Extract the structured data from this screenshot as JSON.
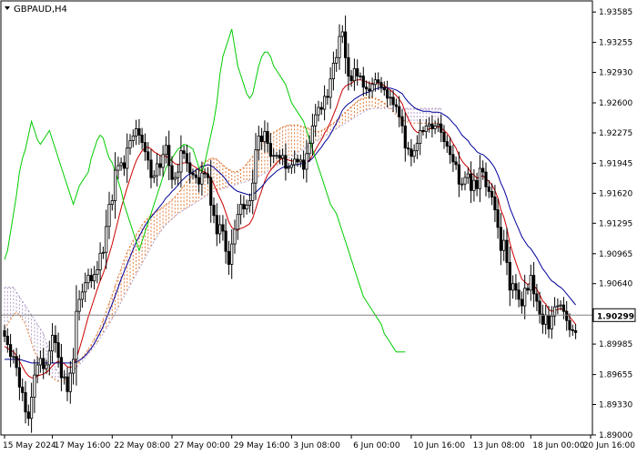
{
  "header": {
    "symbol_label": "GBPAUD,H4"
  },
  "colors": {
    "candles": "#000000",
    "tenkan": "#cc0000",
    "kijun": "#000099",
    "chikou": "#00cc00",
    "cloud_bull": "#e07b39",
    "cloud_bear": "#b39dc9",
    "price_line": "#808080",
    "axis": "#000000"
  },
  "chart_data": {
    "type": "candlestick",
    "indicator": "Ichimoku Kinko Hyo",
    "symbol": "GBPAUD",
    "timeframe": "H4",
    "current_price": 1.90299,
    "current_price_label": "1.90299",
    "ylim": [
      1.89,
      1.93705
    ],
    "y_ticks": [
      "1.93585",
      "1.93255",
      "1.92930",
      "1.92600",
      "1.92275",
      "1.91945",
      "1.91620",
      "1.91295",
      "1.90965",
      "1.90640",
      "1.89985",
      "1.89655",
      "1.89330",
      "1.89000"
    ],
    "x_ticks": [
      "15 May 2024",
      "17 May 16:00",
      "22 May 08:00",
      "27 May 00:00",
      "29 May 16:00",
      "3 Jun 08:00",
      "6 Jun 00:00",
      "10 Jun 16:00",
      "13 Jun 08:00",
      "18 Jun 00:00",
      "20 Jun 16:00"
    ],
    "x_tick_bars": [
      0,
      16,
      36,
      56,
      76,
      96,
      116,
      136,
      156,
      176,
      196
    ],
    "bars": 196,
    "close": [
      1.9007,
      1.8998,
      1.8985,
      1.8985,
      1.8973,
      1.8952,
      1.8946,
      1.8925,
      1.8918,
      1.8941,
      1.8965,
      1.8976,
      1.8983,
      1.8972,
      1.8976,
      1.8991,
      1.9008,
      1.9,
      1.8984,
      1.8962,
      1.8963,
      1.8947,
      1.8967,
      1.8982,
      1.9034,
      1.9047,
      1.9055,
      1.9065,
      1.9073,
      1.9067,
      1.9074,
      1.9079,
      1.9097,
      1.9098,
      1.9126,
      1.915,
      1.9154,
      1.9187,
      1.9192,
      1.9195,
      1.9189,
      1.9211,
      1.9219,
      1.9224,
      1.9232,
      1.9225,
      1.9217,
      1.9207,
      1.9198,
      1.9179,
      1.9181,
      1.9194,
      1.919,
      1.9204,
      1.9214,
      1.9192,
      1.9177,
      1.9179,
      1.9185,
      1.9208,
      1.9205,
      1.9195,
      1.9184,
      1.9182,
      1.9179,
      1.9172,
      1.9184,
      1.9183,
      1.9179,
      1.9149,
      1.9138,
      1.9118,
      1.9128,
      1.9121,
      1.9099,
      1.9085,
      1.9107,
      1.9123,
      1.9139,
      1.915,
      1.9145,
      1.9149,
      1.9154,
      1.9173,
      1.9209,
      1.9224,
      1.9218,
      1.9229,
      1.9216,
      1.9202,
      1.9203,
      1.9203,
      1.92,
      1.9203,
      1.9189,
      1.919,
      1.9193,
      1.9199,
      1.9196,
      1.9198,
      1.9188,
      1.9205,
      1.9216,
      1.9235,
      1.9247,
      1.9255,
      1.9253,
      1.9267,
      1.9266,
      1.9286,
      1.9303,
      1.9309,
      1.9332,
      1.9337,
      1.9309,
      1.9289,
      1.9284,
      1.9297,
      1.9289,
      1.9289,
      1.9277,
      1.9275,
      1.9273,
      1.928,
      1.9285,
      1.9282,
      1.9277,
      1.9274,
      1.9265,
      1.9266,
      1.9258,
      1.9256,
      1.9245,
      1.9235,
      1.9211,
      1.921,
      1.9202,
      1.9208,
      1.9216,
      1.923,
      1.9229,
      1.9235,
      1.9237,
      1.9232,
      1.9235,
      1.9237,
      1.9228,
      1.9218,
      1.9213,
      1.9204,
      1.9196,
      1.9193,
      1.9172,
      1.9172,
      1.9179,
      1.9183,
      1.9165,
      1.9176,
      1.9167,
      1.9189,
      1.9185,
      1.9169,
      1.9164,
      1.9158,
      1.9144,
      1.9125,
      1.91,
      1.9111,
      1.9087,
      1.9057,
      1.9064,
      1.9057,
      1.9047,
      1.904,
      1.9059,
      1.9057,
      1.9073,
      1.9053,
      1.9045,
      1.9031,
      1.902,
      1.903,
      1.9015,
      1.9029,
      1.9039,
      1.904,
      1.9041,
      1.9034,
      1.9024,
      1.9014,
      1.9013,
      1.9011
    ],
    "lines": [
      {
        "name": "Tenkan-sen",
        "color": "#cc0000",
        "values": [
          1.8996,
          1.8994,
          1.8992,
          1.899,
          1.8986,
          1.898,
          1.8974,
          1.8968,
          1.8964,
          1.8962,
          1.8962,
          1.8964,
          1.8965,
          1.8966,
          1.8968,
          1.8971,
          1.8975,
          1.8978,
          1.898,
          1.8979,
          1.8977,
          1.8974,
          1.8973,
          1.8975,
          1.8983,
          1.8993,
          1.9004,
          1.9016,
          1.9028,
          1.9038,
          1.9048,
          1.9058,
          1.9067,
          1.9075,
          1.9085,
          1.9096,
          1.9107,
          1.912,
          1.9133,
          1.9146,
          1.9157,
          1.9168,
          1.9178,
          1.9188,
          1.9197,
          1.9203,
          1.9208,
          1.9211,
          1.9212,
          1.921,
          1.9207,
          1.9205,
          1.9203,
          1.9202,
          1.9202,
          1.92,
          1.9197,
          1.9194,
          1.9193,
          1.9194,
          1.9195,
          1.9195,
          1.9194,
          1.9192,
          1.919,
          1.9187,
          1.9186,
          1.9185,
          1.9183,
          1.9178,
          1.9172,
          1.9164,
          1.9157,
          1.915,
          1.9141,
          1.9131,
          1.9125,
          1.9122,
          1.9122,
          1.9124,
          1.9125,
          1.9127,
          1.9129,
          1.9135,
          1.9145,
          1.9156,
          1.9165,
          1.9175,
          1.9182,
          1.9187,
          1.9191,
          1.9195,
          1.9198,
          1.92,
          1.9199,
          1.9198,
          1.9197,
          1.9197,
          1.9197,
          1.9197,
          1.9195,
          1.9196,
          1.9198,
          1.9203,
          1.9209,
          1.9215,
          1.922,
          1.9227,
          1.9232,
          1.9239,
          1.9247,
          1.9255,
          1.9265,
          1.9274,
          1.9278,
          1.928,
          1.9281,
          1.9284,
          1.9285,
          1.9285,
          1.9284,
          1.9283,
          1.9281,
          1.9281,
          1.9281,
          1.9281,
          1.928,
          1.9279,
          1.9276,
          1.9274,
          1.9271,
          1.9268,
          1.9264,
          1.9259,
          1.925,
          1.9243,
          1.9236,
          1.9231,
          1.9228,
          1.9228,
          1.9229,
          1.923,
          1.9232,
          1.9232,
          1.9233,
          1.9234,
          1.9233,
          1.923,
          1.9227,
          1.9222,
          1.9216,
          1.9211,
          1.9203,
          1.9197,
          1.9193,
          1.919,
          1.9184,
          1.9182,
          1.9178,
          1.918,
          1.9181,
          1.9178,
          1.9175,
          1.9171,
          1.9165,
          1.9157,
          1.9144,
          1.9136,
          1.9124,
          1.9108,
          1.9097,
          1.9087,
          1.9078,
          1.9069,
          1.9066,
          1.9063,
          1.9065,
          1.9062,
          1.9058,
          1.9052,
          1.9045,
          1.9042,
          1.9036,
          1.9034,
          1.9035,
          1.9036,
          1.9037,
          1.9036,
          1.9033,
          1.9028,
          1.9024,
          1.902
        ]
      },
      {
        "name": "Kijun-sen",
        "color": "#000099",
        "values": [
          1.8982,
          1.8982,
          1.8982,
          1.8982,
          1.8982,
          1.8982,
          1.8981,
          1.898,
          1.8979,
          1.8978,
          1.8978,
          1.8978,
          1.8978,
          1.8978,
          1.8978,
          1.8978,
          1.8978,
          1.8978,
          1.8978,
          1.8978,
          1.8978,
          1.8978,
          1.8978,
          1.8978,
          1.8979,
          1.8981,
          1.8983,
          1.8986,
          1.899,
          1.8994,
          1.8999,
          1.9005,
          1.9011,
          1.9018,
          1.9026,
          1.9034,
          1.9042,
          1.9051,
          1.906,
          1.9069,
          1.9077,
          1.9085,
          1.9093,
          1.9101,
          1.9109,
          1.9115,
          1.9121,
          1.9127,
          1.9132,
          1.9136,
          1.914,
          1.9144,
          1.9148,
          1.9152,
          1.9157,
          1.916,
          1.9164,
          1.9167,
          1.9171,
          1.9175,
          1.9178,
          1.9181,
          1.9183,
          1.9185,
          1.9187,
          1.9189,
          1.9191,
          1.9192,
          1.9193,
          1.9192,
          1.919,
          1.9187,
          1.9184,
          1.9181,
          1.9177,
          1.9172,
          1.9169,
          1.9166,
          1.9164,
          1.9163,
          1.9162,
          1.9161,
          1.916,
          1.9161,
          1.9163,
          1.9166,
          1.9169,
          1.9173,
          1.9177,
          1.918,
          1.9183,
          1.9186,
          1.9188,
          1.919,
          1.9191,
          1.9191,
          1.9192,
          1.9193,
          1.9193,
          1.9194,
          1.9194,
          1.9195,
          1.9197,
          1.92,
          1.9204,
          1.9208,
          1.9212,
          1.9217,
          1.9221,
          1.9226,
          1.9232,
          1.9238,
          1.9245,
          1.9252,
          1.9256,
          1.9259,
          1.9261,
          1.9264,
          1.9266,
          1.9268,
          1.927,
          1.9271,
          1.9272,
          1.9274,
          1.9275,
          1.9276,
          1.9276,
          1.9276,
          1.9276,
          1.9276,
          1.9275,
          1.9274,
          1.9272,
          1.927,
          1.9265,
          1.9261,
          1.9258,
          1.9255,
          1.9253,
          1.9252,
          1.9251,
          1.9251,
          1.9251,
          1.925,
          1.925,
          1.925,
          1.9249,
          1.9247,
          1.9245,
          1.9242,
          1.9238,
          1.9235,
          1.923,
          1.9225,
          1.9222,
          1.9219,
          1.9214,
          1.9211,
          1.9207,
          1.9205,
          1.9204,
          1.9201,
          1.9198,
          1.9194,
          1.9189,
          1.9182,
          1.9173,
          1.9166,
          1.9157,
          1.9146,
          1.9138,
          1.913,
          1.9123,
          1.9115,
          1.911,
          1.9105,
          1.9102,
          1.9097,
          1.9092,
          1.9086,
          1.908,
          1.9076,
          1.9071,
          1.9067,
          1.9065,
          1.9062,
          1.906,
          1.9057,
          1.9053,
          1.9049,
          1.9045,
          1.9041
        ]
      },
      {
        "name": "Chikou Span",
        "color": "#00cc00",
        "values": [
          1.909,
          1.91,
          1.912,
          1.914,
          1.916,
          1.9185,
          1.92,
          1.921,
          1.9225,
          1.924,
          1.923,
          1.922,
          1.9215,
          1.922,
          1.9225,
          1.923,
          1.922,
          1.921,
          1.92,
          1.919,
          1.918,
          1.917,
          1.916,
          1.915,
          1.916,
          1.917,
          1.9175,
          1.918,
          1.9185,
          1.92,
          1.921,
          1.922,
          1.9225,
          1.9222,
          1.921,
          1.92,
          1.9195,
          1.9185,
          1.9175,
          1.9165,
          1.915,
          1.914,
          1.913,
          1.912,
          1.911,
          1.91,
          1.911,
          1.912,
          1.913,
          1.914,
          1.915,
          1.916,
          1.917,
          1.918,
          1.919,
          1.9195,
          1.92,
          1.9205,
          1.921,
          1.9212,
          1.9215,
          1.9214,
          1.9212,
          1.921,
          1.92,
          1.919,
          1.9185,
          1.9195,
          1.921,
          1.9225,
          1.924,
          1.926,
          1.929,
          1.931,
          1.932,
          1.933,
          1.934,
          1.932,
          1.93,
          1.929,
          1.928,
          1.927,
          1.9265,
          1.927,
          1.9285,
          1.93,
          1.931,
          1.9315,
          1.9315,
          1.931,
          1.93,
          1.9295,
          1.929,
          1.9285,
          1.928,
          1.927,
          1.926,
          1.9255,
          1.925,
          1.9245,
          1.924,
          1.923,
          1.922,
          1.921,
          1.92,
          1.919,
          1.918,
          1.917,
          1.916,
          1.915,
          1.9145,
          1.914,
          1.913,
          1.912,
          1.911,
          1.91,
          1.909,
          1.908,
          1.907,
          1.906,
          1.905,
          1.9045,
          1.904,
          1.9035,
          1.903,
          1.9025,
          1.902,
          1.901,
          1.9005,
          1.9,
          1.8995,
          1.899,
          1.899,
          1.899,
          1.899
        ]
      }
    ],
    "cloud": {
      "span_a": [
        1.9015,
        1.902,
        1.9025,
        1.903,
        1.9033,
        1.903,
        1.9025,
        1.902,
        1.901,
        1.9,
        1.899,
        1.8985,
        1.898,
        1.8975,
        1.897,
        1.8965,
        1.8962,
        1.896,
        1.8958,
        1.8958,
        1.896,
        1.8962,
        1.8965,
        1.897,
        1.8975,
        1.898,
        1.8984,
        1.8988,
        1.8993,
        1.8998,
        1.9004,
        1.901,
        1.9017,
        1.9025,
        1.9034,
        1.9043,
        1.9052,
        1.9062,
        1.9072,
        1.908,
        1.909,
        1.9098,
        1.9105,
        1.9111,
        1.9117,
        1.9122,
        1.9128,
        1.9132,
        1.9135,
        1.9138,
        1.9141,
        1.9143,
        1.9145,
        1.9147,
        1.915,
        1.9152,
        1.9155,
        1.9158,
        1.9162,
        1.9166,
        1.917,
        1.9175,
        1.9178,
        1.9182,
        1.9186,
        1.919,
        1.9193,
        1.9196,
        1.9198,
        1.92,
        1.92,
        1.9199,
        1.9196,
        1.9193,
        1.919,
        1.9188,
        1.9186,
        1.9185,
        1.9186,
        1.9188,
        1.919,
        1.9194,
        1.9198,
        1.9202,
        1.9206,
        1.921,
        1.9214,
        1.9218,
        1.9222,
        1.9226,
        1.9228,
        1.923,
        1.9232,
        1.9234,
        1.9235,
        1.9236,
        1.9236,
        1.9236,
        1.9236,
        1.9235,
        1.9234,
        1.9233,
        1.9232,
        1.923,
        1.9229,
        1.9229,
        1.923,
        1.9232,
        1.9234,
        1.9236,
        1.9238,
        1.9241,
        1.9244,
        1.9247,
        1.925,
        1.9253,
        1.9256,
        1.9259,
        1.9262,
        1.9264,
        1.9265,
        1.9266,
        1.9266,
        1.9266,
        1.9265,
        1.9264,
        1.9262,
        1.926,
        1.9257,
        1.9254,
        1.925,
        1.9247,
        1.9244,
        1.9242,
        1.924,
        1.9239,
        1.9238,
        1.9238,
        1.9238,
        1.9238,
        1.9238,
        1.9238,
        1.9238,
        1.9238,
        1.9238,
        1.9238,
        1.9238
      ],
      "span_b": [
        1.906,
        1.906,
        1.906,
        1.906,
        1.9055,
        1.905,
        1.9045,
        1.904,
        1.9035,
        1.903,
        1.9025,
        1.902,
        1.9015,
        1.901,
        1.9,
        1.899,
        1.898,
        1.8972,
        1.8968,
        1.8966,
        1.8966,
        1.8966,
        1.8968,
        1.897,
        1.8973,
        1.8976,
        1.898,
        1.8984,
        1.8988,
        1.8992,
        1.8996,
        1.9,
        1.9005,
        1.901,
        1.9015,
        1.902,
        1.9026,
        1.9032,
        1.9038,
        1.9044,
        1.905,
        1.9056,
        1.9062,
        1.9068,
        1.9074,
        1.908,
        1.9086,
        1.9092,
        1.9098,
        1.9104,
        1.911,
        1.9115,
        1.912,
        1.9124,
        1.9128,
        1.9131,
        1.9134,
        1.9137,
        1.914,
        1.9142,
        1.9144,
        1.9146,
        1.9148,
        1.915,
        1.9152,
        1.9154,
        1.9156,
        1.9158,
        1.916,
        1.9162,
        1.9164,
        1.9165,
        1.9166,
        1.9167,
        1.9168,
        1.9169,
        1.917,
        1.9171,
        1.9172,
        1.9173,
        1.9174,
        1.9175,
        1.9176,
        1.9177,
        1.9178,
        1.918,
        1.9182,
        1.9184,
        1.9186,
        1.9188,
        1.919,
        1.9192,
        1.9194,
        1.9196,
        1.9198,
        1.92,
        1.9202,
        1.9204,
        1.9206,
        1.9208,
        1.921,
        1.9212,
        1.9214,
        1.9216,
        1.9218,
        1.922,
        1.9222,
        1.9224,
        1.9226,
        1.9228,
        1.923,
        1.9232,
        1.9234,
        1.9236,
        1.9238,
        1.924,
        1.9242,
        1.9244,
        1.9246,
        1.9248,
        1.925,
        1.9252,
        1.9253,
        1.9254,
        1.9254,
        1.9254,
        1.9254,
        1.9254,
        1.9254,
        1.9254,
        1.9254,
        1.9254,
        1.9254,
        1.9254,
        1.9254,
        1.9254,
        1.9254,
        1.9254,
        1.9254,
        1.9254,
        1.9254,
        1.9254,
        1.9254,
        1.9254,
        1.9254,
        1.9254,
        1.9254
      ]
    }
  }
}
